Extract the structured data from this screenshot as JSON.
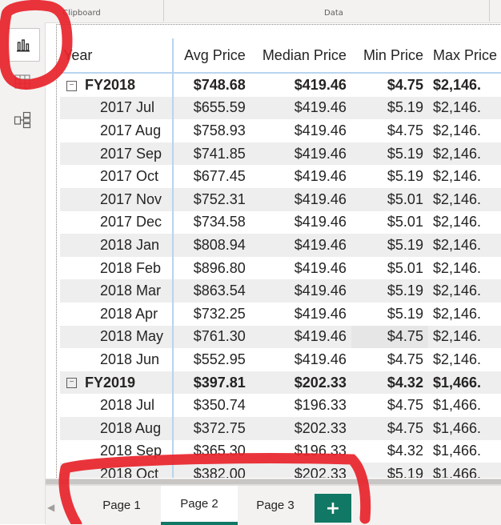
{
  "ribbon": {
    "clipboard_label": "Clipboard",
    "data_label": "Data"
  },
  "nav": {
    "report_icon": "bar-chart-icon",
    "data_icon": "table-grid-icon",
    "model_icon": "model-diagram-icon"
  },
  "table": {
    "columns": [
      "Year",
      "Avg Price",
      "Median Price",
      "Min Price",
      "Max Price"
    ],
    "rows": [
      {
        "kind": "group",
        "label": "FY2018",
        "avg": "$748.68",
        "median": "$419.46",
        "min": "$4.75",
        "max": "$2,146."
      },
      {
        "kind": "child",
        "label": "2017 Jul",
        "avg": "$655.59",
        "median": "$419.46",
        "min": "$5.19",
        "max": "$2,146."
      },
      {
        "kind": "child",
        "label": "2017 Aug",
        "avg": "$758.93",
        "median": "$419.46",
        "min": "$4.75",
        "max": "$2,146."
      },
      {
        "kind": "child",
        "label": "2017 Sep",
        "avg": "$741.85",
        "median": "$419.46",
        "min": "$5.19",
        "max": "$2,146."
      },
      {
        "kind": "child",
        "label": "2017 Oct",
        "avg": "$677.45",
        "median": "$419.46",
        "min": "$5.19",
        "max": "$2,146."
      },
      {
        "kind": "child",
        "label": "2017 Nov",
        "avg": "$752.31",
        "median": "$419.46",
        "min": "$5.01",
        "max": "$2,146."
      },
      {
        "kind": "child",
        "label": "2017 Dec",
        "avg": "$734.58",
        "median": "$419.46",
        "min": "$5.01",
        "max": "$2,146."
      },
      {
        "kind": "child",
        "label": "2018 Jan",
        "avg": "$808.94",
        "median": "$419.46",
        "min": "$5.19",
        "max": "$2,146."
      },
      {
        "kind": "child",
        "label": "2018 Feb",
        "avg": "$896.80",
        "median": "$419.46",
        "min": "$5.01",
        "max": "$2,146."
      },
      {
        "kind": "child",
        "label": "2018 Mar",
        "avg": "$863.54",
        "median": "$419.46",
        "min": "$5.19",
        "max": "$2,146."
      },
      {
        "kind": "child",
        "label": "2018 Apr",
        "avg": "$732.25",
        "median": "$419.46",
        "min": "$5.19",
        "max": "$2,146."
      },
      {
        "kind": "child",
        "label": "2018 May",
        "avg": "$761.30",
        "median": "$419.46",
        "min": "$4.75",
        "max": "$2,146."
      },
      {
        "kind": "child",
        "label": "2018 Jun",
        "avg": "$552.95",
        "median": "$419.46",
        "min": "$4.75",
        "max": "$2,146."
      },
      {
        "kind": "group",
        "label": "FY2019",
        "avg": "$397.81",
        "median": "$202.33",
        "min": "$4.32",
        "max": "$1,466."
      },
      {
        "kind": "child",
        "label": "2018 Jul",
        "avg": "$350.74",
        "median": "$196.33",
        "min": "$4.75",
        "max": "$1,466."
      },
      {
        "kind": "child",
        "label": "2018 Aug",
        "avg": "$372.75",
        "median": "$202.33",
        "min": "$4.75",
        "max": "$1,466."
      },
      {
        "kind": "child",
        "label": "2018 Sep",
        "avg": "$365.30",
        "median": "$196.33",
        "min": "$4.32",
        "max": "$1,466."
      },
      {
        "kind": "child",
        "label": "2018 Oct",
        "avg": "$382.00",
        "median": "$202.33",
        "min": "$5.19",
        "max": "$1,466."
      }
    ]
  },
  "tabs": [
    {
      "label": "Page 1",
      "active": false
    },
    {
      "label": "Page 2",
      "active": true
    },
    {
      "label": "Page 3",
      "active": false
    }
  ],
  "add_tab_label": "+",
  "colors": {
    "accent": "#117865",
    "annotation": "#e8232a",
    "row_alt": "#eeeeee",
    "grid_line": "#b8d4ee"
  }
}
